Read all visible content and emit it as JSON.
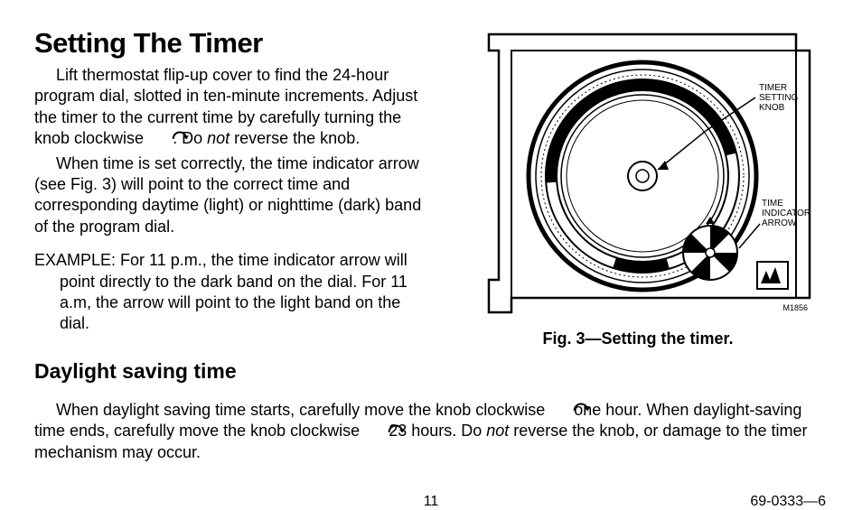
{
  "heading": "Setting The Timer",
  "p1a": "Lift thermostat flip-up cover to find the 24-hour program dial, slotted in ten-minute increments. Adjust the timer to the current time by carefully turning the knob clockwise ",
  "p1b": ". Do ",
  "p1_not": "not",
  "p1c": " reverse the knob.",
  "p2": "When time is set correctly, the time indicator arrow (see Fig. 3) will point to the correct time and corresponding daytime (light) or nighttime (dark) band of the program dial.",
  "example": "EXAMPLE: For 11 p.m., the time indicator arrow will point directly to the dark band on the dial. For 11 a.m, the arrow will point to the light band on the dial.",
  "fig_caption": "Fig. 3—Setting the timer.",
  "fig_label_knob": "TIMER SETTING KNOB",
  "fig_label_arrow": "TIME INDICATOR ARROW",
  "fig_code": "M1856",
  "sub_heading": "Daylight saving time",
  "dst_a": "When daylight saving time starts, carefully move the knob clockwise ",
  "dst_b": " one hour. When daylight-saving time ends, carefully move the knob clockwise ",
  "dst_c": " 23 hours. Do ",
  "dst_not": "not",
  "dst_d": " reverse the knob, or damage to the timer mechanism may occur.",
  "page_number": "11",
  "doc_number": "69-0333—6"
}
